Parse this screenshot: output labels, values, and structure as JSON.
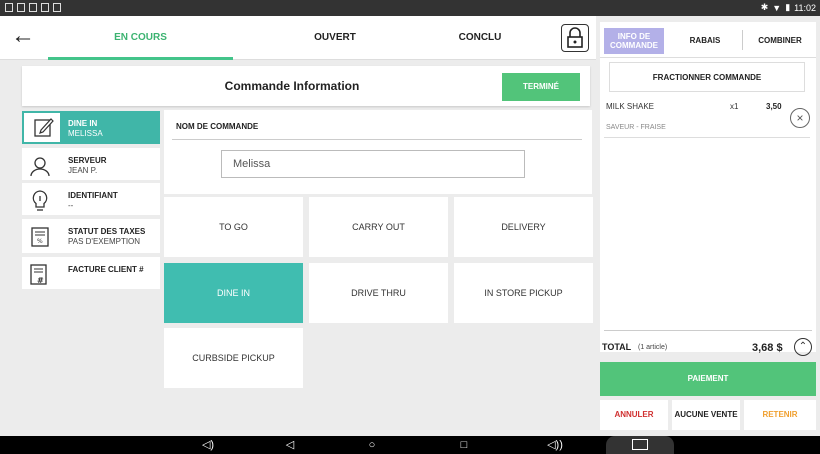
{
  "status_bar": {
    "time": "11:02"
  },
  "tabs": [
    {
      "label": "EN COURS",
      "active": true
    },
    {
      "label": "OUVERT"
    },
    {
      "label": "CONCLU"
    }
  ],
  "info": {
    "title": "Commande Information",
    "termine_label": "TERMINÉ"
  },
  "left_items": [
    {
      "line1": "DINE IN",
      "line2": "MELISSA",
      "icon": "edit-icon",
      "active": true
    },
    {
      "line1": "SERVEUR",
      "line2": "JEAN P.",
      "icon": "user-icon"
    },
    {
      "line1": "IDENTIFIANT",
      "line2": "--",
      "icon": "lightbulb-icon"
    },
    {
      "line1": "STATUT DES TAXES",
      "line2": "PAS D'EXEMPTION",
      "icon": "receipt-icon"
    },
    {
      "line1": "FACTURE CLIENT #",
      "line2": "",
      "icon": "invoice-icon"
    }
  ],
  "order_name": {
    "label": "NOM DE COMMANDE",
    "value": "Melissa"
  },
  "order_types": [
    {
      "label": "TO GO"
    },
    {
      "label": "CARRY OUT"
    },
    {
      "label": "DELIVERY"
    },
    {
      "label": "DINE IN",
      "active": true
    },
    {
      "label": "DRIVE THRU"
    },
    {
      "label": "IN STORE PICKUP"
    },
    {
      "label": "CURBSIDE PICKUP"
    }
  ],
  "right_tabs": {
    "info_line1": "INFO DE",
    "info_line2": "COMMANDE",
    "rabais": "RABAIS",
    "combiner": "COMBINER"
  },
  "cart": {
    "fractionner": "FRACTIONNER COMMANDE",
    "items": [
      {
        "name": "MILK SHAKE",
        "qty": "x1",
        "price": "3,50",
        "modifier": "SAVEUR - FRAISE"
      }
    ],
    "total_label": "TOTAL",
    "total_count": "(1 article)",
    "total_value": "3,68 $"
  },
  "actions": {
    "paiement": "PAIEMENT",
    "annuler": "ANNULER",
    "aucune_vente": "AUCUNE VENTE",
    "retenir": "RETENIR"
  },
  "colors": {
    "accent_green": "#52c47a",
    "teal": "#40bdb0",
    "lavender": "#b3b0e8",
    "annuler": "#d03030",
    "retenir": "#f0a030"
  }
}
